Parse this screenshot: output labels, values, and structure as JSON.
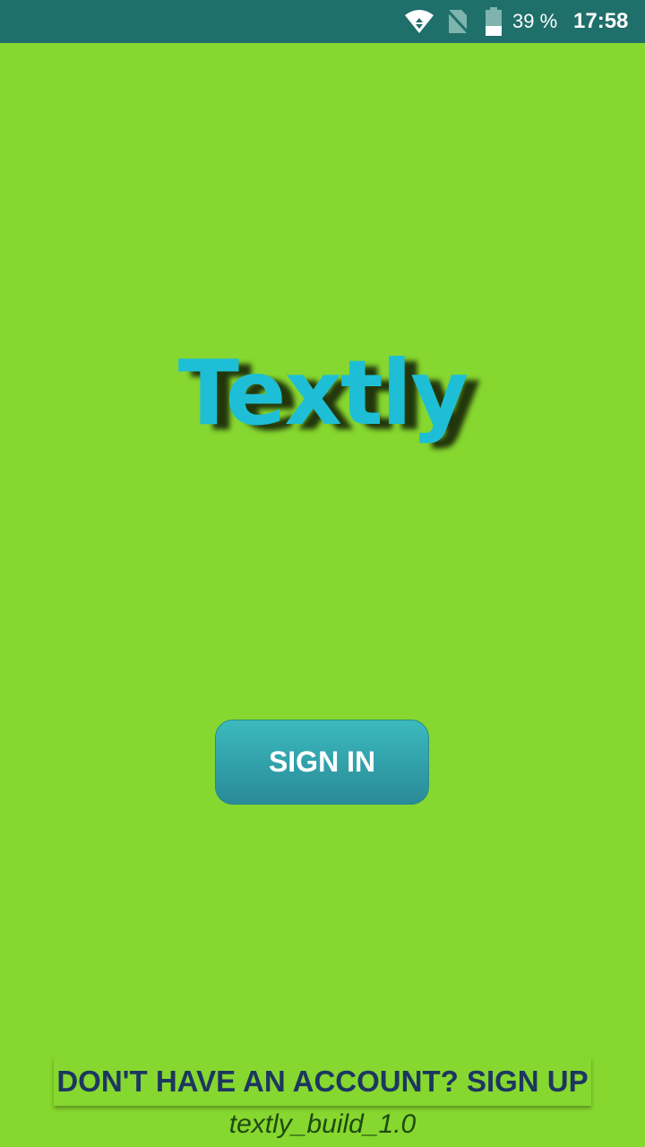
{
  "status_bar": {
    "battery": "39 %",
    "time": "17:58",
    "battery_level": 0.39
  },
  "app": {
    "logo": "Textly",
    "sign_in": "SIGN IN",
    "sign_up": "DON'T HAVE AN ACCOUNT? SIGN UP",
    "build": "textly_build_1.0"
  }
}
